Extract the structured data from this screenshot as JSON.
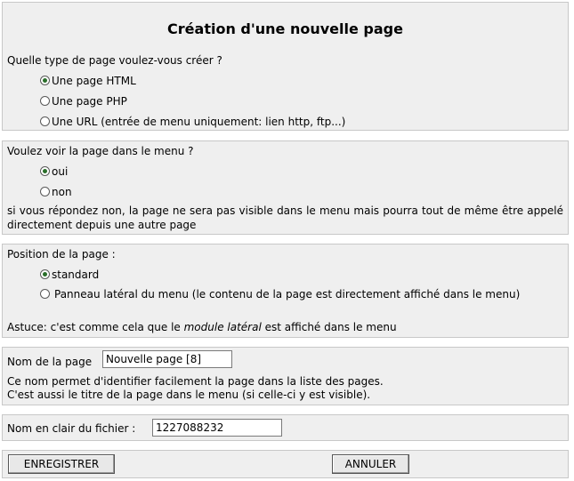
{
  "page_title": "Création d'une nouvelle page",
  "type_section": {
    "question": "Quelle type de page voulez-vous créer ?",
    "options": [
      {
        "label": "Une page HTML",
        "checked": true
      },
      {
        "label": "Une page PHP",
        "checked": false
      },
      {
        "label": "Une URL (entrée de menu uniquement: lien http, ftp...)",
        "checked": false
      }
    ]
  },
  "menu_section": {
    "question": "Voulez voir la page dans le menu ?",
    "options": [
      {
        "label": "oui",
        "checked": true
      },
      {
        "label": "non",
        "checked": false
      }
    ],
    "note": "si vous répondez non, la page ne sera pas visible dans le menu mais pourra tout de même être appelé directement depuis une autre page"
  },
  "position_section": {
    "question": "Position de la page :",
    "options": [
      {
        "label": "standard",
        "checked": true
      },
      {
        "label": "Panneau latéral du menu (le contenu de la page est directement affiché dans le menu)",
        "checked": false
      }
    ],
    "tip_prefix": "Astuce: c'est comme cela que le ",
    "tip_emphasis": "module latéral",
    "tip_suffix": " est affiché dans le menu"
  },
  "name_section": {
    "label": "Nom de la page",
    "value": "Nouvelle page [8]",
    "help_line1": "Ce nom permet d'identifier facilement la page dans la liste des pages.",
    "help_line2": "C'est aussi le titre de la page dans le menu (si celle-ci y est visible)."
  },
  "file_section": {
    "label": "Nom en clair du fichier :",
    "value": "1227088232"
  },
  "actions": {
    "save_label": "ENREGISTRER",
    "cancel_label": "ANNULER"
  }
}
